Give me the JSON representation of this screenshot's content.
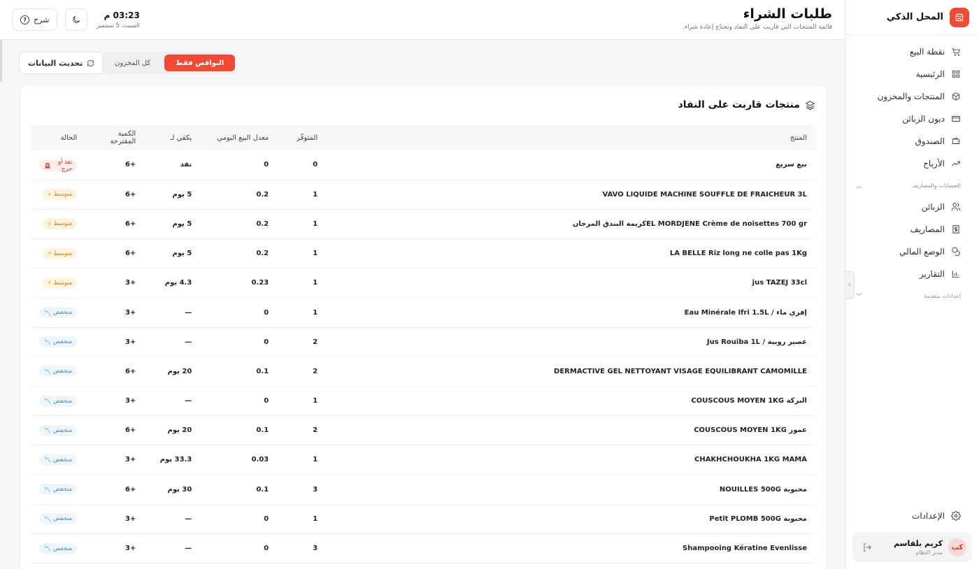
{
  "app": {
    "brand": "المحل الذكي"
  },
  "sidebar": {
    "items": [
      {
        "label": "نقطة البيع",
        "icon": "cart-icon"
      },
      {
        "label": "الرئيسية",
        "icon": "grid-icon"
      },
      {
        "label": "المنتجات والمخزون",
        "icon": "box-icon"
      },
      {
        "label": "ديون الزبائن",
        "icon": "card-icon"
      },
      {
        "label": "الصندوق",
        "icon": "wallet-icon"
      },
      {
        "label": "الأرباح",
        "icon": "trend-icon"
      }
    ],
    "section1": "الحسابات والمصاريف",
    "items2": [
      {
        "label": "الزبائن",
        "icon": "users-icon"
      },
      {
        "label": "المصاريف",
        "icon": "dollar-icon"
      },
      {
        "label": "الوضع المالي",
        "icon": "coins-icon"
      },
      {
        "label": "التقارير",
        "icon": "chart-icon"
      }
    ],
    "section2": "إعدادات متقدمة",
    "settings": "الإعدادات",
    "user": {
      "initials": "كب",
      "name": "كريم بلقاسم",
      "role": "مدير النظام"
    }
  },
  "header": {
    "title": "طلبات الشراء",
    "subtitle": "قائمة المنتجات التي قاربت على النفاد وتحتاج إعادة شراء.",
    "time": "03:23 م",
    "date": "السبت، 5 سبتمبر",
    "explain": "شرح"
  },
  "toolbar": {
    "refresh": "تحديث البيانات",
    "filter_all": "كل المخزون",
    "filter_shortage": "النواقص فقط"
  },
  "card": {
    "title": "منتجات قاربت على النفاد",
    "columns": [
      "المنتج",
      "المتوفّر",
      "معدل البيع اليومي",
      "يكفي لـ",
      "الكمية المقترحة",
      "الحالة"
    ]
  },
  "rows": [
    {
      "product": "بيع سريع",
      "stock": "0",
      "rate": "0",
      "days": "نفد",
      "qty": "+6",
      "status": "نفد أو حرج",
      "level": "crit"
    },
    {
      "product": "VAVO LIQUIDE MACHINE SOUFFLE DE FRAICHEUR 3L",
      "stock": "1",
      "rate": "0.2",
      "days": "5 يوم",
      "qty": "+6",
      "status": "متوسط",
      "level": "mid"
    },
    {
      "product": "EL MORDJENE Crème de noisettes 700 grكريمة البندق المرجان",
      "stock": "1",
      "rate": "0.2",
      "days": "5 يوم",
      "qty": "+6",
      "status": "متوسط",
      "level": "mid"
    },
    {
      "product": "LA BELLE Riz long ne colle pas 1Kg",
      "stock": "1",
      "rate": "0.2",
      "days": "5 يوم",
      "qty": "+6",
      "status": "متوسط",
      "level": "mid"
    },
    {
      "product": "jus TAZEJ 33cl",
      "stock": "1",
      "rate": "0.23",
      "days": "4.3 يوم",
      "qty": "+3",
      "status": "متوسط",
      "level": "mid"
    },
    {
      "product": "إفري ماء / Eau Minérale Ifri 1.5L",
      "stock": "1",
      "rate": "0",
      "days": "—",
      "qty": "+3",
      "status": "منخفض",
      "level": "low"
    },
    {
      "product": "عصير روبية / Jus Rouiba 1L",
      "stock": "2",
      "rate": "0",
      "days": "—",
      "qty": "+3",
      "status": "منخفض",
      "level": "low"
    },
    {
      "product": "DERMACTIVE GEL NETTOYANT VISAGE EQUILIBRANT CAMOMILLE",
      "stock": "2",
      "rate": "0.1",
      "days": "20 يوم",
      "qty": "+6",
      "status": "منخفض",
      "level": "low"
    },
    {
      "product": "البركة COUSCOUS MOYEN 1KG",
      "stock": "1",
      "rate": "0",
      "days": "—",
      "qty": "+3",
      "status": "منخفض",
      "level": "low"
    },
    {
      "product": "عمور COUSCOUS MOYEN 1KG",
      "stock": "2",
      "rate": "0.1",
      "days": "20 يوم",
      "qty": "+6",
      "status": "منخفض",
      "level": "low"
    },
    {
      "product": "CHAKHCHOUKHA 1KG MAMA",
      "stock": "1",
      "rate": "0.03",
      "days": "33.3 يوم",
      "qty": "+3",
      "status": "منخفض",
      "level": "low"
    },
    {
      "product": "محبوبة NOUILLES 500G",
      "stock": "3",
      "rate": "0.1",
      "days": "30 يوم",
      "qty": "+6",
      "status": "منخفض",
      "level": "low"
    },
    {
      "product": "محبوبة Petit PLOMB 500G",
      "stock": "1",
      "rate": "0",
      "days": "—",
      "qty": "+3",
      "status": "منخفض",
      "level": "low"
    },
    {
      "product": "Shampooing Kératine Evenlisse",
      "stock": "3",
      "rate": "0",
      "days": "—",
      "qty": "+3",
      "status": "منخفض",
      "level": "low"
    }
  ]
}
